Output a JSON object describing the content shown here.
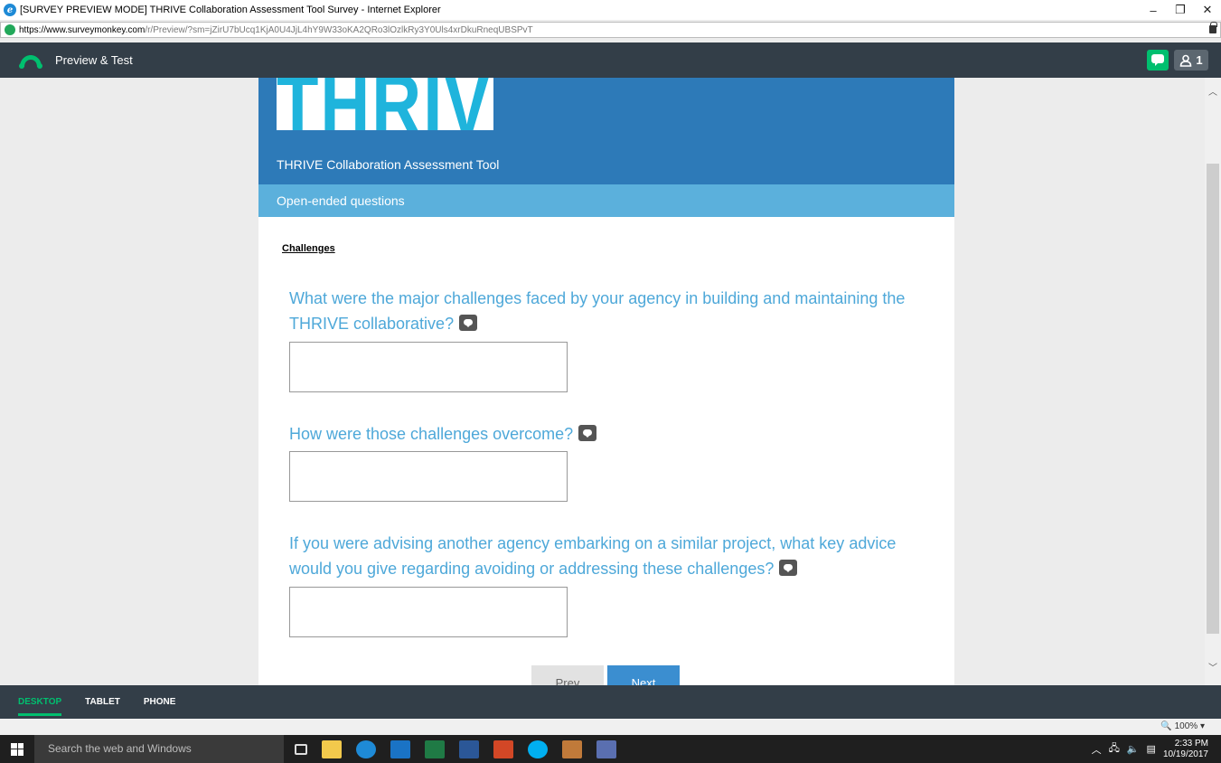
{
  "window": {
    "title": "[SURVEY PREVIEW MODE] THRIVE Collaboration Assessment Tool Survey - Internet Explorer",
    "minimize": "–",
    "restore": "❐",
    "close": "✕"
  },
  "address": {
    "url_host": "https://www.surveymonkey.com",
    "url_path": "/r/Preview/?sm=jZirU7bUcq1KjA0U4JjL4hY9W33oKA2QRo3lOzlkRy3Y0Uls4xrDkuRneqUBSPvT"
  },
  "header": {
    "title": "Preview & Test",
    "user_count": "1"
  },
  "survey": {
    "logo_text": "THRIVE",
    "title": "THRIVE Collaboration Assessment Tool",
    "page_title": "Open-ended questions",
    "section_heading": "Challenges",
    "questions": [
      {
        "text": "What were the major challenges faced by your agency in building and maintaining the THRIVE collaborative?"
      },
      {
        "text": "How were those challenges overcome?"
      },
      {
        "text": "If you were advising another agency embarking on a similar project, what key advice would you give regarding avoiding or addressing these challenges?"
      }
    ],
    "prev_label": "Prev",
    "next_label": "Next"
  },
  "device_tabs": {
    "desktop": "DESKTOP",
    "tablet": "TABLET",
    "phone": "PHONE",
    "active": "DESKTOP"
  },
  "statusbar": {
    "zoom": "🔍 100%  ▾"
  },
  "taskbar": {
    "search_placeholder": "Search the web and Windows",
    "time": "2:33 PM",
    "date": "10/19/2017"
  },
  "colors": {
    "brand_green": "#00bf6f",
    "header_dark": "#333e48",
    "banner_blue": "#2d7ab8",
    "page_bar_blue": "#5bb0dc",
    "question_blue": "#4ea8d9"
  }
}
